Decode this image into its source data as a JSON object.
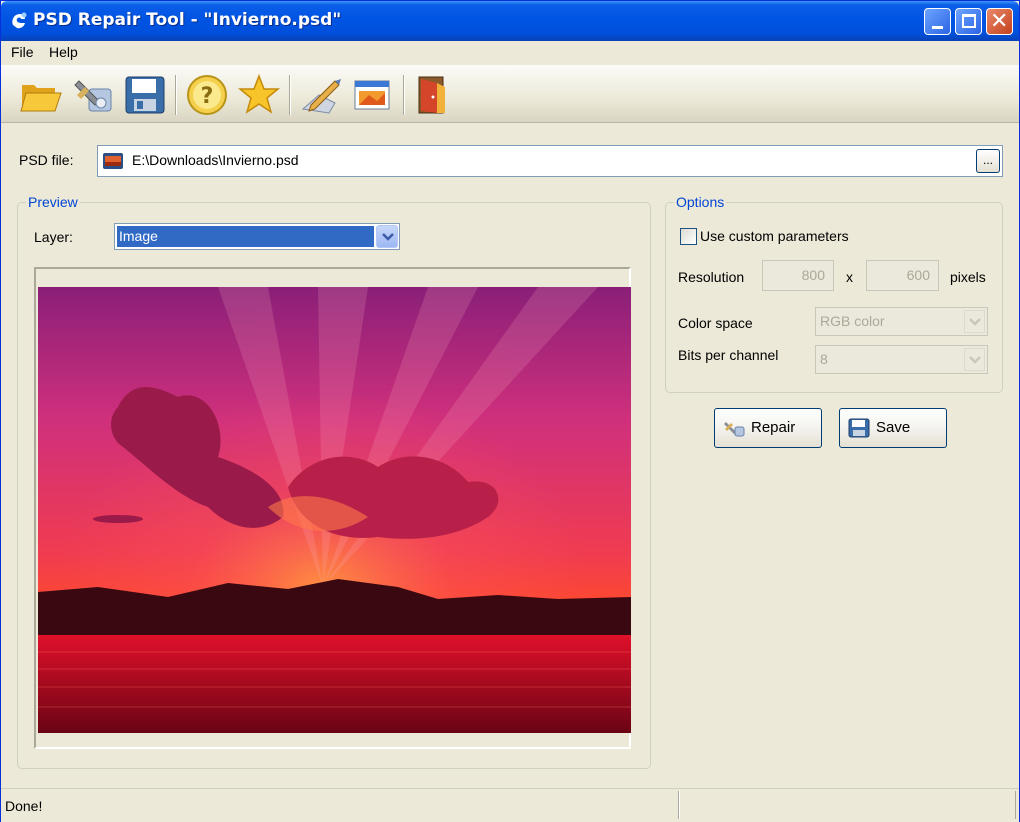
{
  "window": {
    "title": "PSD Repair Tool - \"Invierno.psd\""
  },
  "menu": {
    "file": "File",
    "help": "Help"
  },
  "toolbar": {
    "items": [
      "open-folder-icon",
      "wizard-tool-icon",
      "save-disk-icon",
      "help-icon",
      "favorite-star-icon",
      "edit-pen-icon",
      "image-window-icon",
      "exit-door-icon"
    ]
  },
  "psd_file": {
    "label": "PSD file:",
    "value": "E:\\Downloads\\Invierno.psd",
    "browse_label": "..."
  },
  "preview": {
    "group_title": "Preview",
    "layer_label": "Layer:",
    "layer_value": "Image"
  },
  "options": {
    "group_title": "Options",
    "use_custom_label": "Use custom parameters",
    "use_custom_checked": false,
    "resolution_label": "Resolution",
    "width": "800",
    "x_label": "x",
    "height": "600",
    "pixels_label": "pixels",
    "color_space_label": "Color space",
    "color_space_value": "RGB color",
    "bits_label": "Bits per channel",
    "bits_value": "8"
  },
  "actions": {
    "repair": "Repair",
    "save": "Save"
  },
  "status": {
    "text": "Done!"
  },
  "colors": {
    "titlebar": "#0054e3",
    "selection": "#316ac5",
    "group_title": "#0046d5",
    "window_bg": "#ece9d8"
  }
}
